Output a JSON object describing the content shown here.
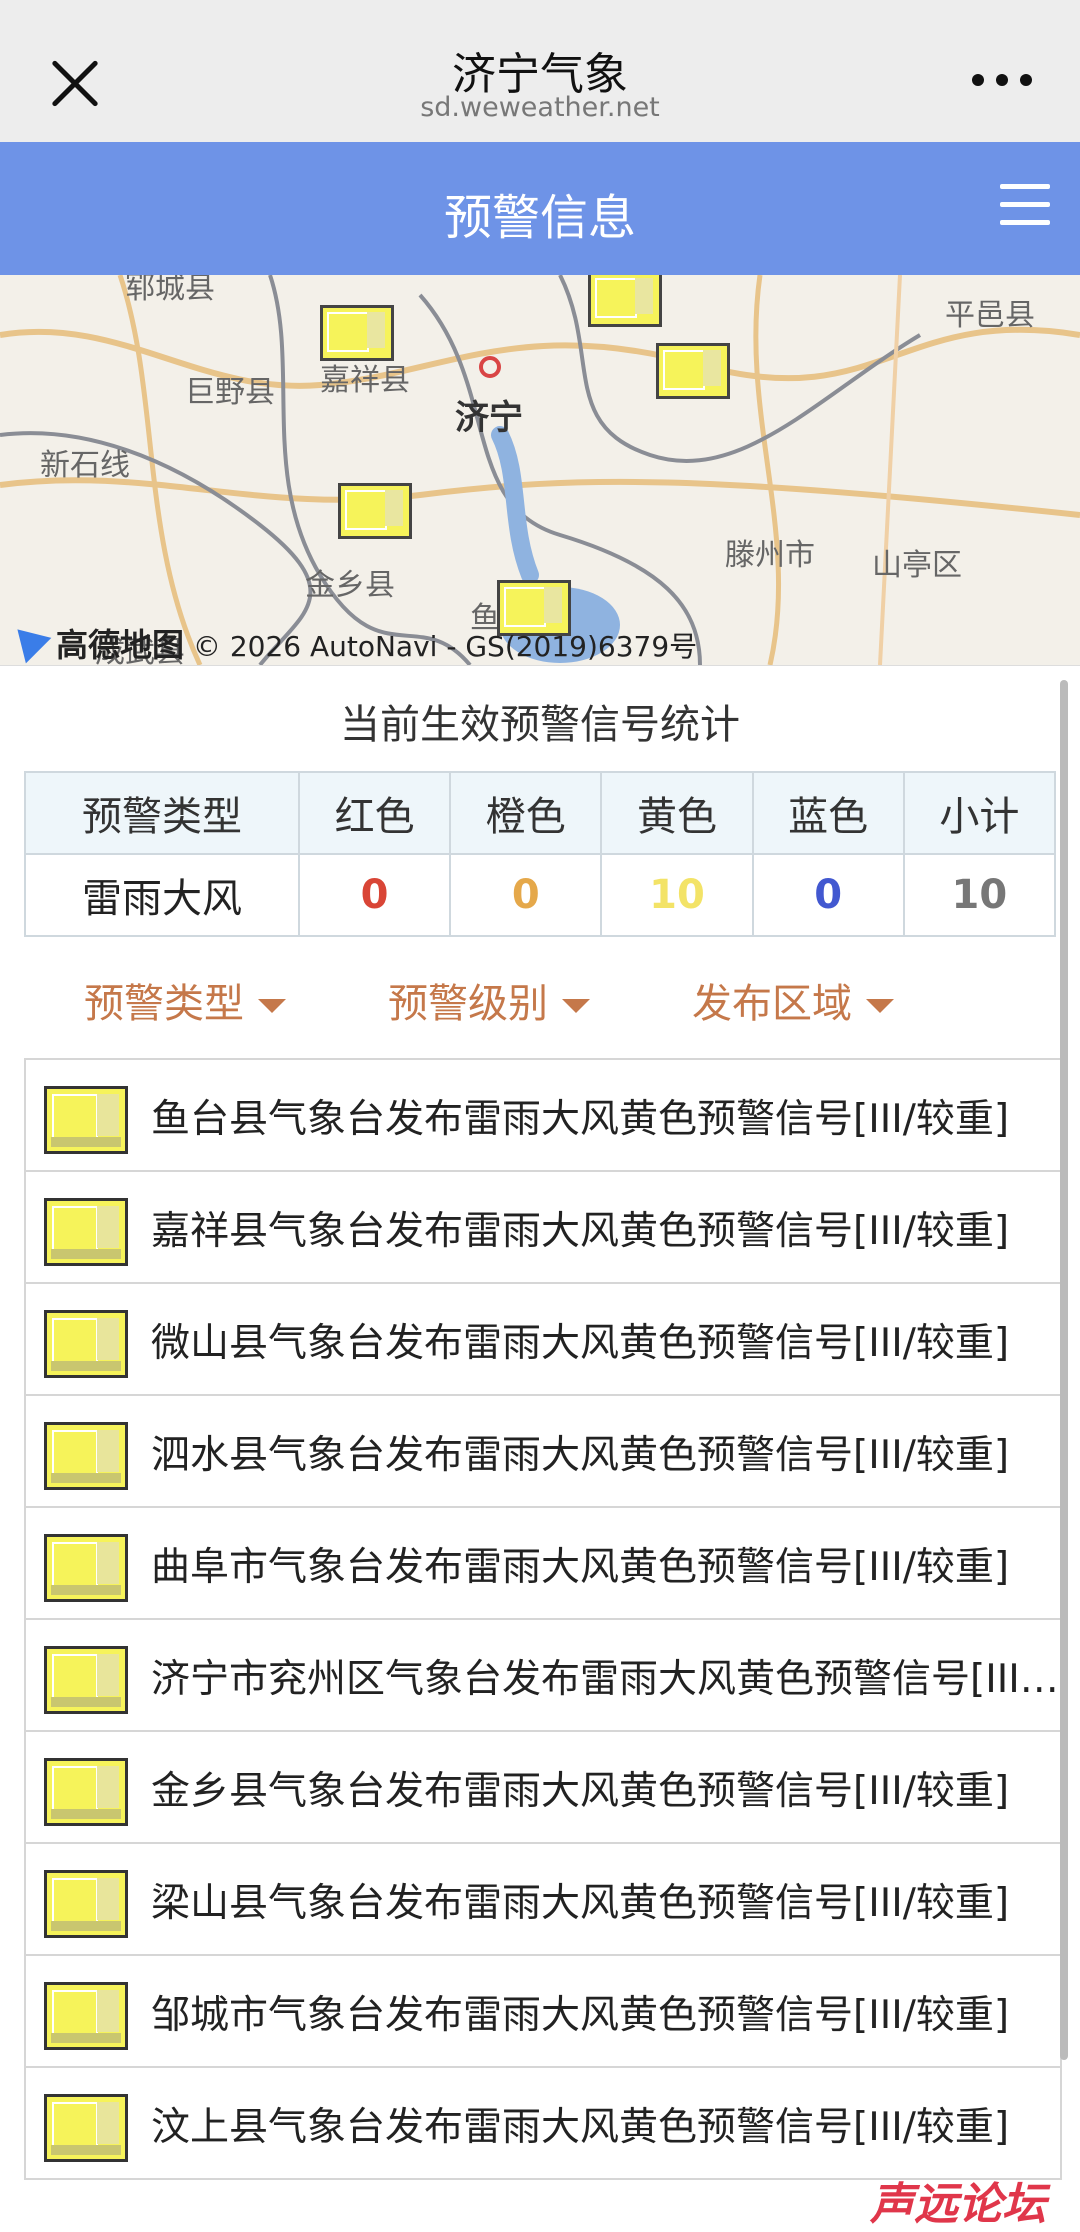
{
  "browser": {
    "title": "济宁气象",
    "url": "sd.weweather.net"
  },
  "header": {
    "title": "预警信息"
  },
  "map": {
    "labels": {
      "juye": "巨野县",
      "jiaxiang": "嘉祥县",
      "jining": "济宁",
      "xinshi": "新石线",
      "jinxiang": "金乡县",
      "tengzhou": "滕州市",
      "shanting": "山亭区",
      "pingyi": "平邑县",
      "yucheng": "郓城县",
      "chengwu": "成武县",
      "yu": "鱼"
    },
    "provider": "高德地图",
    "copyright": "© 2026 AutoNavi - GS(2019)6379号"
  },
  "stats": {
    "title": "当前生效预警信号统计",
    "headers": [
      "预警类型",
      "红色",
      "橙色",
      "黄色",
      "蓝色",
      "小计"
    ],
    "row": {
      "type": "雷雨大风",
      "red": "0",
      "orange": "0",
      "yellow": "10",
      "blue": "0",
      "total": "10"
    },
    "colors": {
      "red": "#d94536",
      "orange": "#e5a84a",
      "yellow": "#f3e367",
      "blue": "#4258d0",
      "total": "#777777"
    }
  },
  "filters": {
    "type": "预警类型",
    "level": "预警级别",
    "area": "发布区域"
  },
  "warnings": [
    "鱼台县气象台发布雷雨大风黄色预警信号[III/较重]",
    "嘉祥县气象台发布雷雨大风黄色预警信号[III/较重]",
    "微山县气象台发布雷雨大风黄色预警信号[III/较重]",
    "泗水县气象台发布雷雨大风黄色预警信号[III/较重]",
    "曲阜市气象台发布雷雨大风黄色预警信号[III/较重]",
    "济宁市兖州区气象台发布雷雨大风黄色预警信号[III/较重]",
    "金乡县气象台发布雷雨大风黄色预警信号[III/较重]",
    "梁山县气象台发布雷雨大风黄色预警信号[III/较重]",
    "邹城市气象台发布雷雨大风黄色预警信号[III/较重]",
    "汶上县气象台发布雷雨大风黄色预警信号[III/较重]"
  ],
  "watermark": "声远论坛",
  "theme": {
    "header_blue": "#6e93e7",
    "filter_orange": "#c5784a",
    "warning_yellow": "#f6f35a"
  }
}
